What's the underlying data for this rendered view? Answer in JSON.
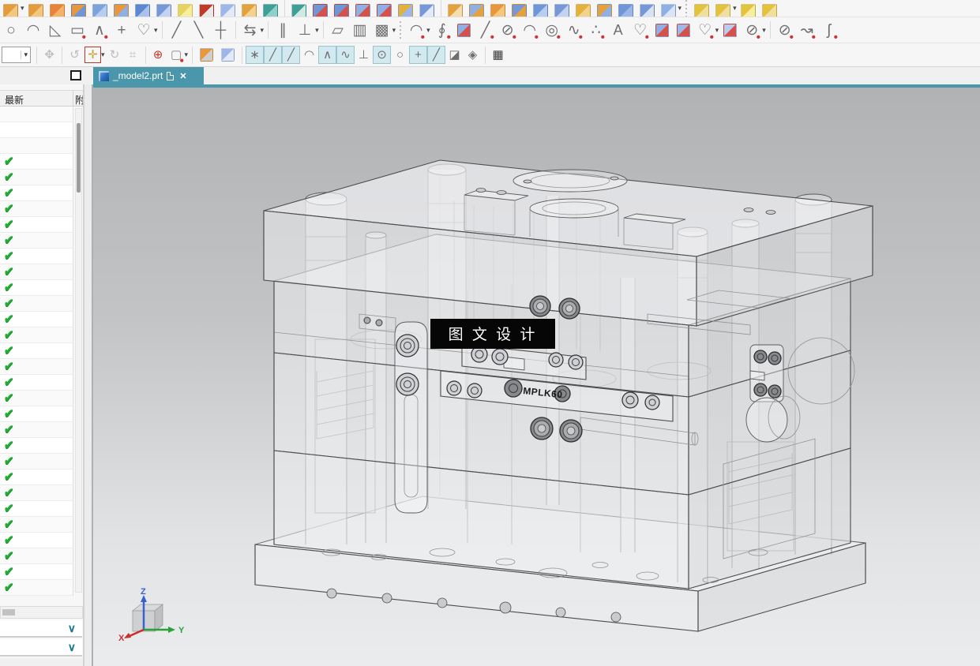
{
  "glyphs": {
    "dropdown": "▾",
    "check": "✔",
    "chevron": "∨",
    "close": "✕"
  },
  "colors": {
    "accent_teal": "#4a96ab",
    "check_green": "#1db133",
    "toggle_bg": "#d2e9ef",
    "red_box": "#b03a2e"
  },
  "tabbar": {
    "tab_title": "_model2.prt"
  },
  "sidebar": {
    "col1_header": "最新",
    "col2_header": "附",
    "blank_rows": 3,
    "check_rows": 28
  },
  "viewport": {
    "watermark": "图 文 设 计",
    "part_label": "MPLK60",
    "triad": {
      "x": "X",
      "y": "Y",
      "z": "Z"
    }
  },
  "toolbar": {
    "row1": [
      {
        "n": "pattern-feature",
        "t": "cube",
        "c1": "#e39b3e",
        "c2": "#f3c77e"
      },
      {
        "t": "drop",
        "n": "pattern-more"
      },
      {
        "n": "pattern-feature-alt",
        "t": "cube",
        "c1": "#e39b3e",
        "c2": "#f3c77e"
      },
      {
        "n": "scatter-feature",
        "t": "cube",
        "c1": "#e8833c",
        "c2": "#f5b36a"
      },
      {
        "n": "unite-boolean",
        "t": "cube",
        "c1": "#e8973c",
        "c2": "#6f97d8"
      },
      {
        "n": "sheet-body",
        "t": "cube",
        "c1": "#7ba3dc",
        "c2": "#b9cdf0"
      },
      {
        "n": "thicken",
        "t": "cube",
        "c1": "#e8973c",
        "c2": "#8fb0e4"
      },
      {
        "n": "tube",
        "t": "cube",
        "c1": "#5d87cf",
        "c2": "#aac2ec"
      },
      {
        "n": "cylinder",
        "t": "cube",
        "c1": "#7697d8",
        "c2": "#c2d2f0"
      },
      {
        "n": "sphere",
        "t": "cube",
        "c1": "#e7d35f",
        "c2": "#f7ef9e"
      },
      {
        "n": "bounded-block",
        "t": "cube",
        "c1": "#c0392b",
        "c2": "#e9e9e9"
      },
      {
        "n": "bounding-body",
        "t": "cube",
        "c1": "#9db8e8",
        "c2": "#e3e9f7"
      },
      {
        "n": "swept-flange",
        "t": "cube",
        "c1": "#e3a23d",
        "c2": "#f2d28c"
      },
      {
        "n": "intersect-boolean",
        "t": "cube",
        "c1": "#3e9e98",
        "c2": "#8fd0c8"
      },
      {
        "t": "sep"
      },
      {
        "n": "join-body",
        "t": "cube",
        "c1": "#3e9e98",
        "c2": "#cfe9e4"
      },
      {
        "n": "trim-body",
        "t": "cube",
        "c1": "#6f97d8",
        "c2": "#d6514b"
      },
      {
        "n": "trim-sheet",
        "t": "cube",
        "c1": "#6f97d8",
        "c2": "#d6514b"
      },
      {
        "n": "split-body",
        "t": "cube",
        "c1": "#8fb0e4",
        "c2": "#d6514b"
      },
      {
        "n": "split-face",
        "t": "cube",
        "c1": "#8fb0e4",
        "c2": "#d6514b"
      },
      {
        "n": "delete-body",
        "t": "cube",
        "c1": "#e3b23d",
        "c2": "#9db8e8"
      },
      {
        "n": "rotate-body",
        "t": "cube",
        "c1": "#7697d8",
        "c2": "#e3e9f7"
      },
      {
        "t": "sep"
      },
      {
        "n": "shell",
        "t": "cube",
        "c1": "#e3a23d",
        "c2": "#f5deb0"
      },
      {
        "n": "emboss",
        "t": "cube",
        "c1": "#8fb0e4",
        "c2": "#e3a23d"
      },
      {
        "n": "draft",
        "t": "cube",
        "c1": "#e8973c",
        "c2": "#f3c77e"
      },
      {
        "n": "flange",
        "t": "cube",
        "c1": "#7697d8",
        "c2": "#e3a23d"
      },
      {
        "n": "sweep-along-guide",
        "t": "cube",
        "c1": "#6f97d8",
        "c2": "#b9cdf0"
      },
      {
        "n": "boss",
        "t": "cube",
        "c1": "#7697d8",
        "c2": "#c2d2f0"
      },
      {
        "n": "pad",
        "t": "cube",
        "c1": "#e3b23d",
        "c2": "#f2d28c"
      },
      {
        "n": "offset-surface",
        "t": "cube",
        "c1": "#e3a23d",
        "c2": "#8fb0e4"
      },
      {
        "n": "wave-link",
        "t": "cube",
        "c1": "#6f97d8",
        "c2": "#9db8e8"
      },
      {
        "n": "datum-plane",
        "t": "cube",
        "c1": "#7697d8",
        "c2": "#d8e2f5"
      },
      {
        "n": "layer-settings",
        "t": "cube",
        "c1": "#8fb0e4",
        "c2": "#dbe4f6"
      },
      {
        "t": "drop",
        "n": "body-more"
      },
      {
        "t": "dsep"
      },
      {
        "n": "move-face",
        "t": "cube",
        "c1": "#e3c23d",
        "c2": "#f0e0a0"
      },
      {
        "n": "pull-face",
        "t": "cube",
        "c1": "#e3c23d",
        "c2": "#f0e0a0"
      },
      {
        "t": "drop",
        "n": "face-more"
      },
      {
        "n": "resize-face",
        "t": "cube",
        "c1": "#e3c23d",
        "c2": "#f7ef9e"
      },
      {
        "n": "delete-face",
        "t": "cube",
        "c1": "#e3c23d",
        "c2": "#f0e0a0"
      }
    ],
    "row2": [
      {
        "n": "circle",
        "g": "○"
      },
      {
        "n": "fillet",
        "g": "◠"
      },
      {
        "n": "chamfer",
        "g": "◺"
      },
      {
        "n": "rectangle",
        "g": "▭",
        "red": 1
      },
      {
        "n": "profile",
        "g": "∧",
        "red": 1
      },
      {
        "n": "point",
        "g": "+"
      },
      {
        "n": "studio-spline",
        "g": "♡"
      },
      {
        "t": "drop",
        "n": "spline-more"
      },
      {
        "t": "sep"
      },
      {
        "n": "trim-curve",
        "g": "╱"
      },
      {
        "n": "extend-curve",
        "g": "╲"
      },
      {
        "n": "make-corner",
        "g": "┼"
      },
      {
        "t": "sep"
      },
      {
        "n": "offset-curve",
        "g": "⇆"
      },
      {
        "t": "drop",
        "n": "offset-more"
      },
      {
        "t": "sep"
      },
      {
        "n": "parallel-constraint",
        "g": "∥"
      },
      {
        "n": "perpendicular-constraint",
        "g": "⊥"
      },
      {
        "t": "drop",
        "n": "constraint-more"
      },
      {
        "t": "sep"
      },
      {
        "n": "pattern-curve",
        "g": "▱"
      },
      {
        "n": "mirror-curve",
        "g": "▥"
      },
      {
        "n": "project-curve",
        "g": "▩"
      },
      {
        "t": "drop",
        "n": "project-more"
      },
      {
        "t": "dsep"
      },
      {
        "n": "arc",
        "g": "◠",
        "red": 1
      },
      {
        "t": "drop",
        "n": "arc-more"
      },
      {
        "n": "helix",
        "g": "∮",
        "red": 1
      },
      {
        "n": "bridge-curve",
        "t": "cube",
        "c1": "#8fb0e4",
        "c2": "#d6514b"
      },
      {
        "n": "line",
        "g": "╱",
        "red": 1
      },
      {
        "n": "circle-by-point",
        "g": "⊘",
        "red": 1
      },
      {
        "n": "arc-3point",
        "g": "◠",
        "red": 1
      },
      {
        "n": "conic",
        "g": "◎",
        "red": 1
      },
      {
        "n": "spline",
        "g": "∿",
        "red": 1
      },
      {
        "n": "point-set",
        "g": "∴",
        "red": 1
      },
      {
        "n": "text",
        "g": "A",
        "big": 1
      },
      {
        "n": "heart-curve",
        "g": "♡",
        "red": 1
      },
      {
        "n": "curve-on-surface",
        "t": "cube",
        "c1": "#8fb0e4",
        "c2": "#d6514b"
      },
      {
        "n": "isoparametric-curve",
        "t": "cube",
        "c1": "#9db8e8",
        "c2": "#d6514b"
      },
      {
        "n": "heart-curve-alt",
        "g": "♡",
        "red": 1
      },
      {
        "t": "drop",
        "n": "curve-more"
      },
      {
        "n": "intersection-curve",
        "t": "cube",
        "c1": "#b9cdf0",
        "c2": "#d6514b"
      },
      {
        "n": "section-curve",
        "g": "⊘",
        "red": 1
      },
      {
        "t": "drop",
        "n": "section-more"
      },
      {
        "t": "sep"
      },
      {
        "n": "offset-curve-3d",
        "g": "⊘",
        "red": 1
      },
      {
        "n": "tangent-curve",
        "g": "↝",
        "red": 1
      },
      {
        "n": "smooth-curve",
        "g": "ʃ",
        "red": 1
      }
    ],
    "row3": [
      {
        "n": "assembly-explode",
        "g": "✥",
        "c": "#bdbdbd"
      },
      {
        "t": "sep"
      },
      {
        "n": "replace-reference-set",
        "g": "↺",
        "c": "#bdbdbd"
      },
      {
        "n": "snap-point-filter",
        "g": "✛",
        "c": "#c9a23a",
        "box": 1
      },
      {
        "t": "drop",
        "n": "filter-more"
      },
      {
        "n": "move-component",
        "g": "↻",
        "c": "#bdbdbd"
      },
      {
        "n": "assembly-constraints",
        "g": "⌗",
        "c": "#bdbdbd"
      },
      {
        "t": "sep"
      },
      {
        "n": "point-constructor",
        "g": "⊕",
        "c": "#c0392b"
      },
      {
        "n": "rectangle-select",
        "g": "▢",
        "c": "#8a8a8a",
        "red": 1
      },
      {
        "t": "drop",
        "n": "select-more"
      },
      {
        "t": "sep"
      },
      {
        "n": "shaded-view",
        "t": "cube",
        "c1": "#e8973c",
        "c2": "#cfcfcf"
      },
      {
        "n": "wireframe-view",
        "t": "cube",
        "c1": "#9db8e8",
        "c2": "#e3e9f7"
      },
      {
        "t": "sep"
      },
      {
        "n": "snap-point-enable",
        "g": "∗",
        "tg": 1,
        "on": 1
      },
      {
        "n": "snap-endpoint",
        "g": "╱",
        "tg": 1,
        "on": 1
      },
      {
        "n": "snap-midpoint",
        "g": "╱",
        "tg": 1,
        "on": 1
      },
      {
        "n": "snap-control-point",
        "g": "◠",
        "tg": 1,
        "on": 0
      },
      {
        "n": "snap-intersection",
        "g": "∧",
        "tg": 1,
        "on": 1
      },
      {
        "n": "snap-spline-point",
        "g": "∿",
        "tg": 1,
        "on": 1
      },
      {
        "n": "snap-quadrant",
        "g": "⊥",
        "tg": 1,
        "on": 0
      },
      {
        "n": "snap-arc-center",
        "g": "⊙",
        "tg": 1,
        "on": 1
      },
      {
        "n": "snap-circle",
        "g": "○",
        "tg": 1,
        "on": 0
      },
      {
        "n": "snap-existing-point",
        "g": "+",
        "tg": 1,
        "on": 1
      },
      {
        "n": "snap-point-on-curve",
        "g": "╱",
        "tg": 1,
        "on": 1
      },
      {
        "n": "snap-face",
        "g": "◪",
        "tg": 1,
        "on": 0
      },
      {
        "n": "snap-sphere",
        "g": "◈",
        "tg": 1,
        "on": 0
      },
      {
        "t": "sep"
      },
      {
        "n": "grid",
        "g": "▦",
        "c": "#3c3c3c"
      }
    ]
  }
}
